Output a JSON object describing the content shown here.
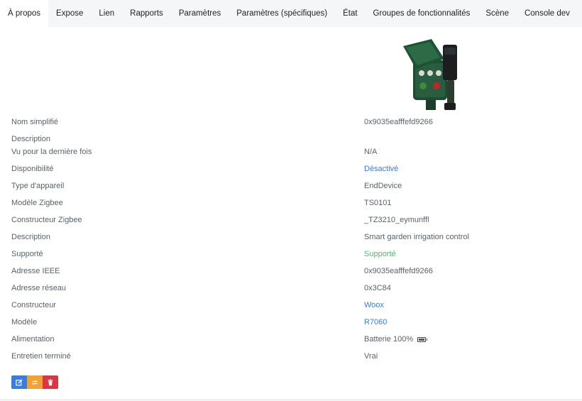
{
  "tabs": [
    {
      "label": "À propos",
      "active": true
    },
    {
      "label": "Expose"
    },
    {
      "label": "Lien"
    },
    {
      "label": "Rapports"
    },
    {
      "label": "Paramètres"
    },
    {
      "label": "Paramètres (spécifiques)"
    },
    {
      "label": "État"
    },
    {
      "label": "Groupes de fonctionnalités"
    },
    {
      "label": "Scène"
    },
    {
      "label": "Console dev"
    }
  ],
  "device_image": {
    "icon": "garden-irrigation-device-icon"
  },
  "rows": [
    {
      "label": "Nom simplifié",
      "value": "0x9035eafffefd9266"
    },
    {
      "label": "Description",
      "value": ""
    },
    {
      "label": "Vu pour la dernière fois",
      "value": "N/A"
    },
    {
      "label": "Disponibilité",
      "value": "Désactivé"
    },
    {
      "label": "Type d'appareil",
      "value": "EndDevice"
    },
    {
      "label": "Modèle Zigbee",
      "value": "TS0101"
    },
    {
      "label": "Constructeur Zigbee",
      "value": "_TZ3210_eymunffl"
    },
    {
      "label": "Description",
      "value": "Smart garden irrigation control"
    },
    {
      "label": "Supporté",
      "value": "Supporté"
    },
    {
      "label": "Adresse IEEE",
      "value": "0x9035eafffefd9266"
    },
    {
      "label": "Adresse réseau",
      "value": "0x3C84"
    },
    {
      "label": "Constructeur",
      "value": "Woox"
    },
    {
      "label": "Modèle",
      "value": "R7060"
    },
    {
      "label": "Alimentation",
      "value": "Batterie 100%",
      "icon": "battery-full-icon"
    },
    {
      "label": "Entretien terminé",
      "value": "Vrai"
    }
  ],
  "actions": [
    {
      "name": "edit-button",
      "icon": "edit-icon",
      "color": "#3b7ddd"
    },
    {
      "name": "reconfigure-button",
      "icon": "refresh-icon",
      "color": "#f0a234"
    },
    {
      "name": "delete-button",
      "icon": "trash-icon",
      "color": "#dc3545"
    }
  ],
  "colors": {
    "link": "#3b7ddd",
    "success": "#4fb870",
    "tab_bg": "#f5f6f7"
  }
}
